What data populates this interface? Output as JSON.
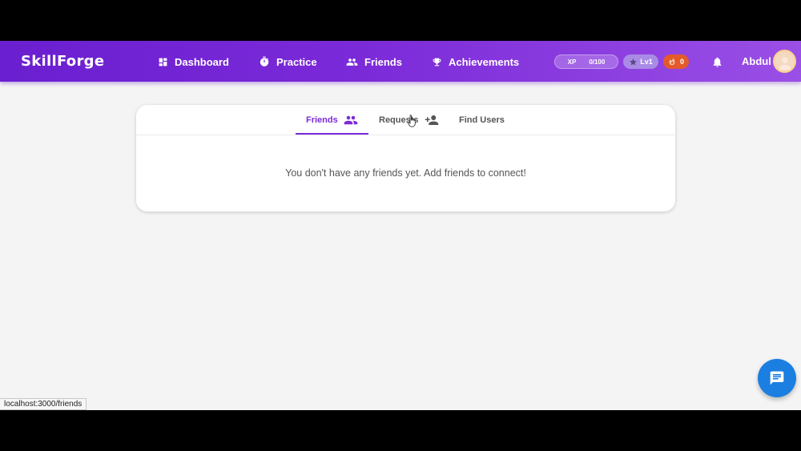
{
  "app": {
    "brand": "SkillForge"
  },
  "nav": [
    {
      "label": "Dashboard",
      "icon": "dashboard-icon"
    },
    {
      "label": "Practice",
      "icon": "stopwatch-icon"
    },
    {
      "label": "Friends",
      "icon": "people-icon"
    },
    {
      "label": "Achievements",
      "icon": "trophy-icon"
    }
  ],
  "stats": {
    "xp_label": "XP",
    "xp_value": "0/100",
    "level": "Lv1",
    "streak": "0"
  },
  "user": {
    "name": "Abdul"
  },
  "tabs": [
    {
      "label": "Friends",
      "icon": "people-icon",
      "active": true
    },
    {
      "label": "Requests",
      "icon": "person-add-icon",
      "active": false
    },
    {
      "label": "Find Users",
      "active": false
    }
  ],
  "empty_message": "You don't have any friends yet. Add friends to connect!",
  "status_bar": {
    "url": "localhost:3000/friends"
  },
  "colors": {
    "accent": "#7a2bd6",
    "header_start": "#6a1fd0",
    "header_end": "#9a4fe6",
    "fab": "#1a7fe0",
    "streak": "#e35a2b"
  }
}
